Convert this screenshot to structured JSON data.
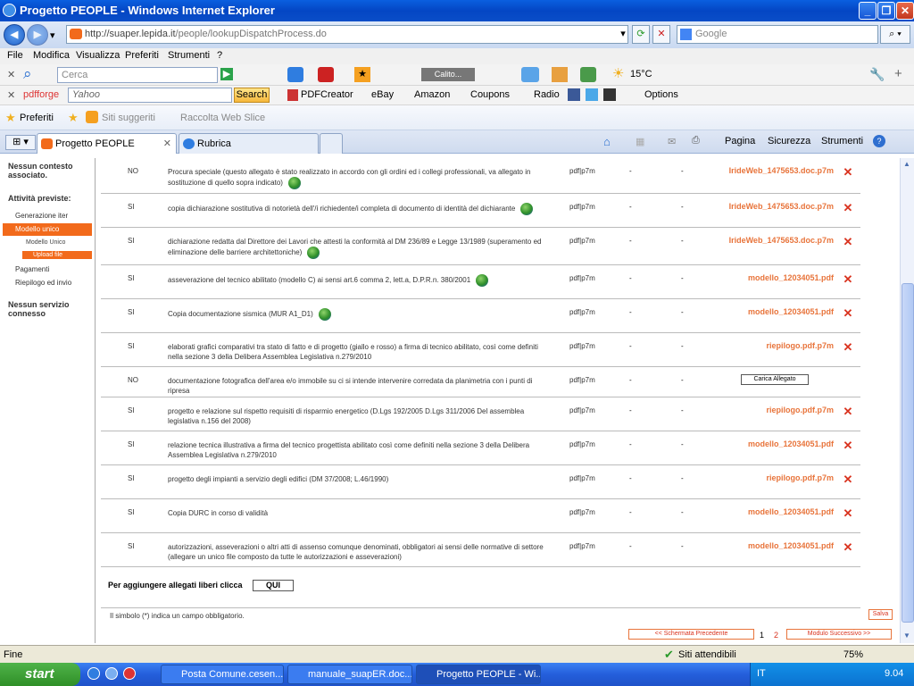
{
  "window": {
    "title": "Progetto PEOPLE - Windows Internet Explorer"
  },
  "address": {
    "url_host": "http://suaper.lepida.it",
    "url_path": "/people/lookupDispatchProcess.do"
  },
  "search_engine": {
    "placeholder": "Google"
  },
  "menu": [
    "File",
    "Modifica",
    "Visualizza",
    "Preferiti",
    "Strumenti",
    "?"
  ],
  "toolbar1": {
    "cerca_placeholder": "Cerca",
    "weather": "15°C",
    "player_label": "Calito..."
  },
  "toolbar2": {
    "brand": "pdfforge",
    "yahoo_placeholder": "Yahoo",
    "search_button": "Search",
    "pdfcreator": "PDFCreator",
    "ebay": "eBay",
    "amazon": "Amazon",
    "coupons": "Coupons",
    "radio": "Radio",
    "options": "Options"
  },
  "favbar": {
    "preferiti": "Preferiti",
    "siti": "Siti suggeriti",
    "raccolta": "Raccolta Web Slice"
  },
  "tabs": [
    {
      "label": "Progetto PEOPLE"
    },
    {
      "label": "Rubrica"
    }
  ],
  "commandbar": {
    "pagina": "Pagina",
    "sicurezza": "Sicurezza",
    "strumenti": "Strumenti"
  },
  "sidebar": {
    "context": "Nessun contesto associato.",
    "activities": "Attività previste:",
    "items": [
      "Generazione iter",
      "Modello unico",
      "Pagamenti",
      "Riepilogo ed invio"
    ],
    "subitems": [
      "Modello Unico",
      "Upload file"
    ],
    "service": "Nessun servizio connesso"
  },
  "documents": [
    {
      "obl": "NO",
      "desc": "Procura speciale (questo allegato è stato realizzato in accordo con gli ordini ed i collegi professionali, va allegato in sostituzione di quello sopra indicato)",
      "fmt": "pdf|p7m",
      "d1": "-",
      "d2": "-",
      "file": "IrideWeb_1475653.doc.p7m"
    },
    {
      "obl": "SI",
      "desc": "copia dichiarazione sostitutiva di notorietà dell'/i richiedente/i completa di documento di identità del dichiarante",
      "fmt": "pdf|p7m",
      "d1": "-",
      "d2": "-",
      "file": "IrideWeb_1475653.doc.p7m"
    },
    {
      "obl": "SI",
      "desc": "dichiarazione redatta dal Direttore dei Lavori che attesti la conformità al DM 236/89 e Legge 13/1989 (superamento ed eliminazione delle barriere architettoniche)",
      "fmt": "pdf|p7m",
      "d1": "-",
      "d2": "-",
      "file": "IrideWeb_1475653.doc.p7m"
    },
    {
      "obl": "SI",
      "desc": "asseverazione del tecnico abilitato (modello C) ai sensi art.6 comma 2, lett.a, D.P.R.n. 380/2001",
      "fmt": "pdf|p7m",
      "d1": "-",
      "d2": "-",
      "file": "modello_12034051.pdf"
    },
    {
      "obl": "SI",
      "desc": "Copia documentazione sismica (MUR A1_D1)",
      "fmt": "pdf|p7m",
      "d1": "-",
      "d2": "-",
      "file": "modello_12034051.pdf"
    },
    {
      "obl": "SI",
      "desc": "elaborati grafici comparativi tra stato di fatto e di progetto (giallo e rosso) a firma di tecnico abilitato, così come definiti nella sezione 3 della Delibera Assemblea Legislativa n.279/2010",
      "fmt": "pdf|p7m",
      "d1": "-",
      "d2": "-",
      "file": "riepilogo.pdf.p7m"
    },
    {
      "obl": "NO",
      "desc": "documentazione fotografica dell'area e/o immobile su ci si intende intervenire corredata da planimetria con i punti di ripresa",
      "fmt": "pdf|p7m",
      "d1": "-",
      "d2": "-",
      "file": ""
    },
    {
      "obl": "SI",
      "desc": "progetto e relazione sul rispetto requisiti di risparmio energetico (D.Lgs 192/2005 D.Lgs 311/2006 Del assemblea legislativa n.156 del 2008)",
      "fmt": "pdf|p7m",
      "d1": "-",
      "d2": "-",
      "file": "riepilogo.pdf.p7m"
    },
    {
      "obl": "SI",
      "desc": "relazione tecnica illustrativa a firma del tecnico progettista abilitato così come definiti nella sezione 3 della Delibera Assemblea Legislativa n.279/2010",
      "fmt": "pdf|p7m",
      "d1": "-",
      "d2": "-",
      "file": "modello_12034051.pdf"
    },
    {
      "obl": "SI",
      "desc": "progetto degli impianti a servizio degli edifici (DM 37/2008; L.46/1990)",
      "fmt": "pdf|p7m",
      "d1": "-",
      "d2": "-",
      "file": "riepilogo.pdf.p7m"
    },
    {
      "obl": "SI",
      "desc": "Copia DURC in corso di validità",
      "fmt": "pdf|p7m",
      "d1": "-",
      "d2": "-",
      "file": "modello_12034051.pdf"
    },
    {
      "obl": "SI",
      "desc": "autorizzazioni, asseverazioni o altri atti di assenso comunque denominati, obbligatori ai sensi delle normative di settore (allegare un unico file composto da tutte le autorizzazioni e asseverazioni)",
      "fmt": "pdf|p7m",
      "d1": "-",
      "d2": "-",
      "file": "modello_12034051.pdf"
    }
  ],
  "carica_label": "Carica Allegato",
  "free_attach": {
    "text": "Per aggiungere allegati liberi clicca",
    "button": "QUI"
  },
  "mandatory_note": "Il simbolo (*) indica un campo obbligatorio.",
  "salva": "Salva",
  "nav": {
    "prev": "<< Schermata Precedente",
    "page1": "1",
    "page2": "2",
    "next": "Modulo Successivo >>"
  },
  "status": {
    "left": "Fine",
    "zone": "Siti attendibili",
    "zoom": "75%"
  },
  "taskbar": {
    "start": "start",
    "items": [
      "Posta Comune.cesen...",
      "manuale_suapER.doc...",
      "Progetto PEOPLE - Wi..."
    ],
    "lang": "IT",
    "clock": "9.04"
  },
  "colors": {
    "accent": "#f26a1b",
    "file_link": "#e8743b",
    "delete": "#d9331f"
  }
}
